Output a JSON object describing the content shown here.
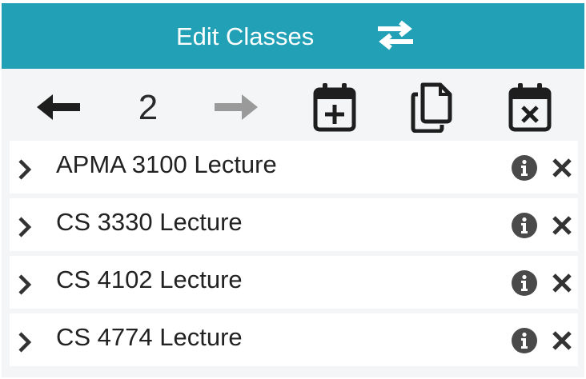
{
  "header": {
    "title": "Edit Classes",
    "swap_icon": "swap-arrows-icon",
    "background": "#22a1b6"
  },
  "toolbar": {
    "prev_icon": "arrow-left-icon",
    "page_number": "2",
    "next_icon": "arrow-right-icon",
    "next_disabled": true,
    "add_icon": "calendar-plus-icon",
    "copy_icon": "copy-icon",
    "clear_icon": "calendar-x-icon"
  },
  "classes": [
    {
      "label": "APMA 3100 Lecture"
    },
    {
      "label": "CS 3330 Lecture"
    },
    {
      "label": "CS 4102 Lecture"
    },
    {
      "label": "CS 4774 Lecture"
    }
  ],
  "row_icons": {
    "expand": "chevron-right-icon",
    "info": "info-icon",
    "remove": "close-icon"
  }
}
